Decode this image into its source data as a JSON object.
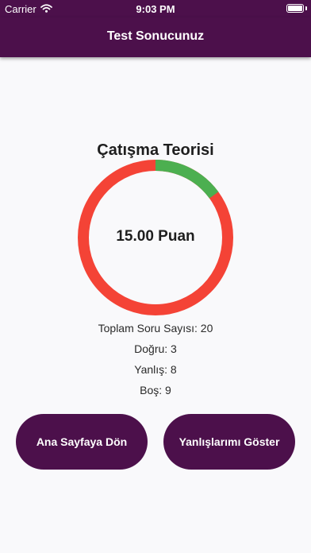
{
  "status_bar": {
    "carrier": "Carrier",
    "time": "9:03 PM",
    "battery_level": 1.0
  },
  "app_bar": {
    "title": "Test Sonucunuz"
  },
  "result": {
    "test_name": "Çatışma Teorisi",
    "score_text": "15.00 Puan",
    "chart": {
      "correct_fraction": 0.15,
      "wrong_fraction": 0.85,
      "correct_color": "#4caf50",
      "wrong_color": "#f44336"
    },
    "stats": {
      "total": "Toplam Soru Sayısı: 20",
      "correct": "Doğru: 3",
      "wrong": "Yanlış: 8",
      "empty": "Boş: 9"
    }
  },
  "actions": {
    "home_label": "Ana Sayfaya Dön",
    "show_wrong_label": "Yanlışlarımı Göster"
  },
  "colors": {
    "primary": "#4c104b",
    "background": "#f9f9fb"
  }
}
